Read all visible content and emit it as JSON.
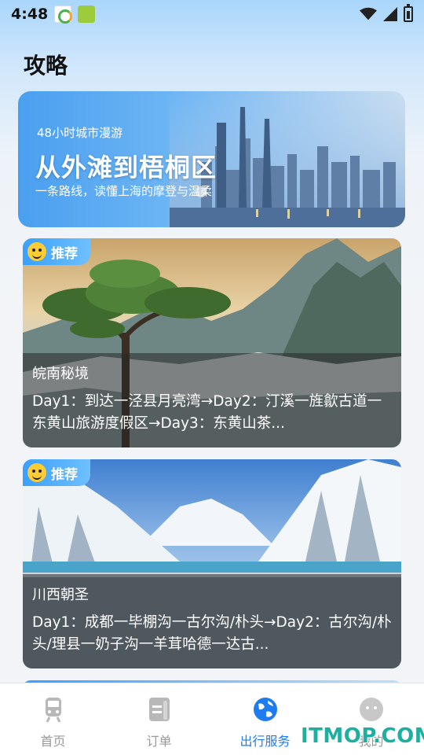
{
  "status_bar": {
    "time": "4:48"
  },
  "page": {
    "title": "攻略"
  },
  "banner": {
    "subtitle": "48小时城市漫游",
    "title": "从外滩到梧桐区",
    "description": "一条路线，读懂上海的摩登与温柔"
  },
  "cards": [
    {
      "badge": "推荐",
      "title": "皖南秘境",
      "description": "Day1：到达一泾县月亮湾→Day2：汀溪一旌歙古道一东黄山旅游度假区→Day3：东黄山茶..."
    },
    {
      "badge": "推荐",
      "title": "川西朝圣",
      "description": "Day1：成都一毕棚沟一古尔沟/朴头→Day2：古尔沟/朴头/理县一奶子沟一羊茸哈德一达古..."
    }
  ],
  "tabs": [
    {
      "label": "首页",
      "icon": "train-icon",
      "active": false
    },
    {
      "label": "订单",
      "icon": "order-icon",
      "active": false
    },
    {
      "label": "出行服务",
      "icon": "globe-icon",
      "active": true
    },
    {
      "label": "我的",
      "icon": "profile-icon",
      "active": false
    }
  ],
  "watermark": "ITMOP.COM",
  "colors": {
    "accent": "#1e7cf0",
    "badge": "#3aa0ff",
    "watermark": "#1db0a0"
  }
}
